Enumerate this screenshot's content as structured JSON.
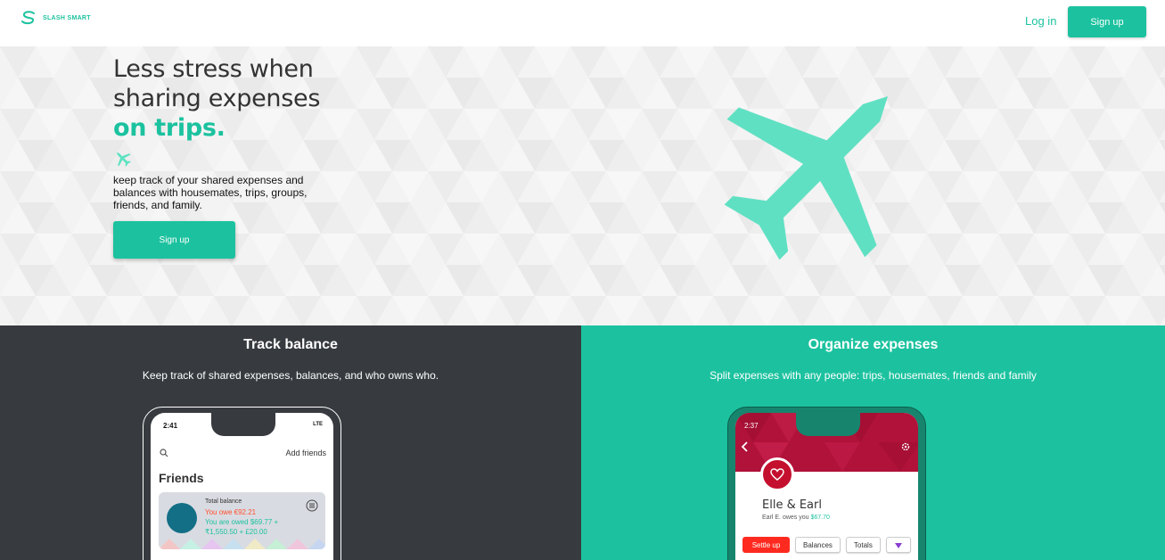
{
  "header": {
    "logo_text": "SLASH SMART",
    "login_label": "Log in",
    "signup_label": "Sign up"
  },
  "hero": {
    "headline_line1": "Less stress when",
    "headline_line2": "sharing expenses",
    "headline_accent": "on trips.",
    "description": "keep track of your shared expenses and balances with housemates, trips, groups, friends, and family.",
    "signup_label": "Sign up",
    "illustration_icon": "airplane-icon"
  },
  "features": {
    "left": {
      "title": "Track balance",
      "subtitle": "Keep track of shared expenses, balances, and who owns who.",
      "phone": {
        "time": "2:41",
        "network": "LTE",
        "add_friends_label": "Add friends",
        "friends_title": "Friends",
        "total_balance_label": "Total balance",
        "you_owe": "You owe €92.21",
        "you_are_owed": "You are owed $69.77 +",
        "you_are_owed_more": "₹1,550.50 + £20.00"
      }
    },
    "right": {
      "title": "Organize expenses",
      "subtitle": "Split expenses with any people: trips, housemates, friends and family",
      "phone": {
        "time": "2:37",
        "group_name": "Elle & Earl",
        "owes_text": "Earl E. owes you",
        "owes_amount": "$67.70",
        "settle_up_label": "Settle up",
        "balances_label": "Balances",
        "totals_label": "Totals"
      }
    }
  },
  "colors": {
    "brand": "#1cc29f",
    "dark_panel": "#373b3f",
    "owe_red": "#ff4f2e",
    "group_header": "#b0123a"
  }
}
